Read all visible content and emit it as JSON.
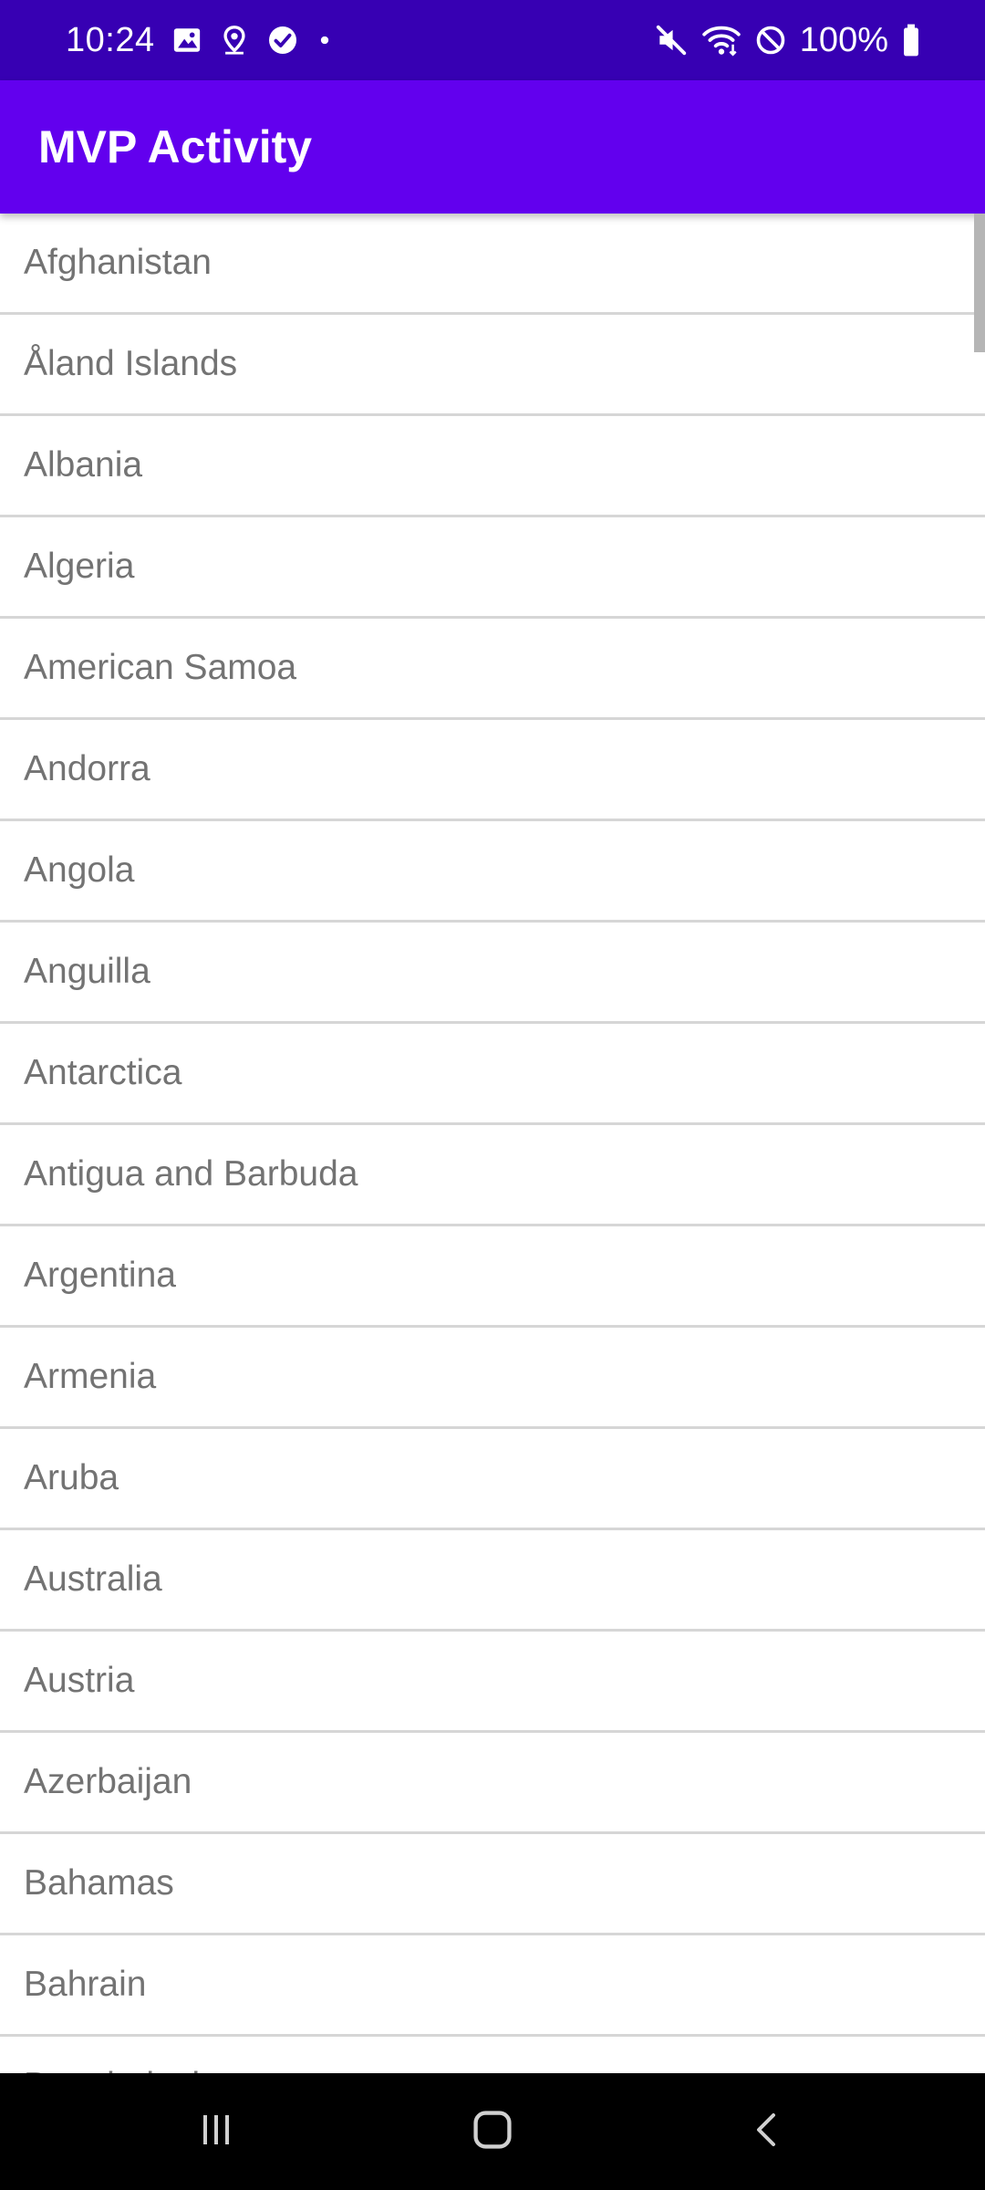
{
  "status_bar": {
    "time": "10:24",
    "battery": "100%",
    "left_icons": [
      "gallery-icon",
      "location-icon",
      "check-circle-icon",
      "dot-icon"
    ],
    "right_icons": [
      "mute-icon",
      "wifi-icon",
      "blocked-icon",
      "battery-icon"
    ]
  },
  "app_bar": {
    "title": "MVP Activity"
  },
  "list": {
    "items": [
      "Afghanistan",
      "Åland Islands",
      "Albania",
      "Algeria",
      "American Samoa",
      "Andorra",
      "Angola",
      "Anguilla",
      "Antarctica",
      "Antigua and Barbuda",
      "Argentina",
      "Armenia",
      "Aruba",
      "Australia",
      "Austria",
      "Azerbaijan",
      "Bahamas",
      "Bahrain",
      "Bangladesh"
    ]
  },
  "nav_bar": {
    "buttons": [
      "recent-apps-icon",
      "home-icon",
      "back-icon"
    ]
  },
  "colors": {
    "status_bar": "#3700B3",
    "app_bar": "#6200EE",
    "list_text": "#737373",
    "divider": "#d6d6d6"
  }
}
